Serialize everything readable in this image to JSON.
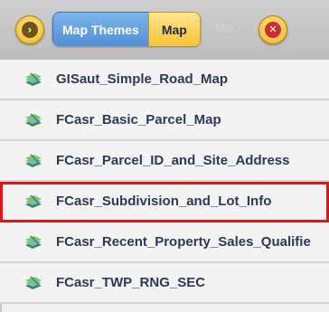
{
  "header": {
    "back_button_glyph": "›",
    "tabs": [
      {
        "label": "Map Themes",
        "state": "active"
      },
      {
        "label": "Map",
        "state": "inactive"
      }
    ],
    "faded_label": "Mo",
    "close_button_glyph": "✕"
  },
  "list": {
    "items": [
      {
        "label": "GISaut_Simple_Road_Map",
        "icon": "map-layers-icon",
        "selected": false
      },
      {
        "label": "FCasr_Basic_Parcel_Map",
        "icon": "map-layers-icon",
        "selected": false
      },
      {
        "label": "FCasr_Parcel_ID_and_Site_Address",
        "icon": "map-layers-icon",
        "selected": false
      },
      {
        "label": "FCasr_Subdivision_and_Lot_Info",
        "icon": "map-layers-icon",
        "selected": true
      },
      {
        "label": "FCasr_Recent_Property_Sales_Qualifie",
        "icon": "map-layers-icon",
        "selected": false
      },
      {
        "label": "FCasr_TWP_RNG_SEC",
        "icon": "map-layers-icon",
        "selected": false
      }
    ]
  },
  "colors": {
    "accent_blue": "#4f8fd6",
    "accent_yellow": "#f6c431",
    "selection_red": "#e0141b",
    "text": "#2d3a55"
  }
}
